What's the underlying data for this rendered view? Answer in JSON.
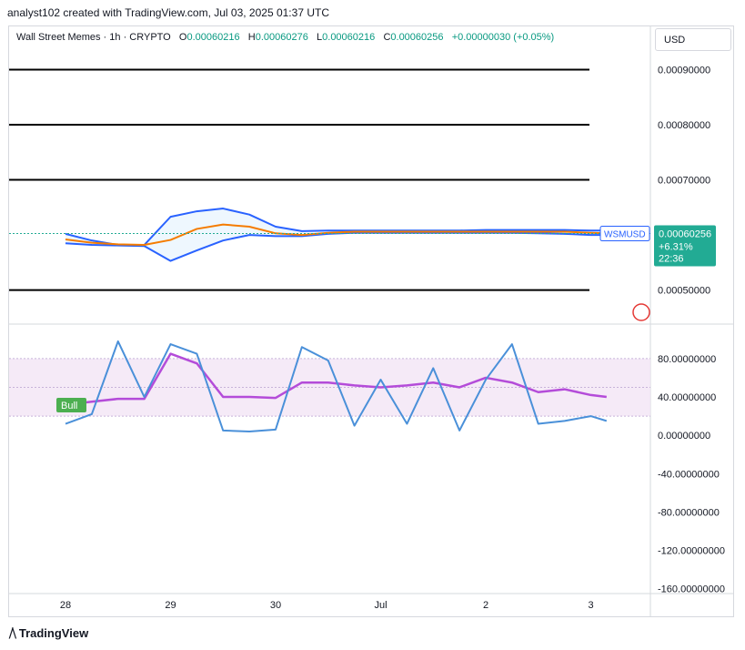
{
  "header": {
    "credit": "analyst102 created with TradingView.com, Jul 03, 2025 01:37 UTC",
    "symbol": "Wall Street Memes · 1h · CRYPTO",
    "o_label": "O",
    "o_value": "0.00060216",
    "h_label": "H",
    "h_value": "0.00060276",
    "l_label": "L",
    "l_value": "0.00060216",
    "c_label": "C",
    "c_value": "0.00060256",
    "change": "+0.00000030 (+0.05%)"
  },
  "toolbar": {
    "currency_label": "USD"
  },
  "price_tag": {
    "symbol": "WSMUSD",
    "price": "0.00060256",
    "change": "+6.31%",
    "countdown": "22:36"
  },
  "badge": {
    "label": "Bull"
  },
  "footer": {
    "brand": "TradingView"
  },
  "colors": {
    "upper_band": "#2962ff",
    "basis": "#f57c00",
    "stoch_k": "#4a90d9",
    "stoch_d": "#b44cd9",
    "tag_bg": "#22ab94",
    "bull": "#4caf50",
    "level_line": "#000000",
    "band_fill": "#e3f2fd",
    "osc_fill": "#f3e5f5"
  },
  "chart_data": [
    {
      "type": "line",
      "title": "Wall Street Memes · 1h · CRYPTO",
      "xlabel": "",
      "ylabel": "",
      "x_ticks": [
        "28",
        "29",
        "30",
        "Jul",
        "2",
        "3"
      ],
      "y_ticks": [
        "0.00090000",
        "0.00080000",
        "0.00070000",
        "0.00050000"
      ],
      "ylim": [
        0.00044,
        0.00098
      ],
      "horizontal_levels": [
        0.0009,
        0.0008,
        0.0007,
        0.0005
      ],
      "last_price": 0.00060256,
      "x": [
        0,
        0.25,
        0.5,
        0.75,
        1.0,
        1.25,
        1.5,
        1.75,
        2.0,
        2.25,
        2.5,
        2.75,
        3.0,
        3.25,
        3.5,
        3.75,
        4.0,
        4.25,
        4.5,
        4.75,
        5.0,
        5.15
      ],
      "series": [
        {
          "values": [
            0.000592,
            0.000586,
            0.000583,
            0.000582,
            0.000591,
            0.000611,
            0.000619,
            0.000615,
            0.000603,
            0.0006,
            0.000604,
            0.000606,
            0.000606,
            0.000606,
            0.000606,
            0.000606,
            0.000606,
            0.000606,
            0.000606,
            0.000606,
            0.000604,
            0.000603
          ]
        },
        {
          "values": [
            0.000602,
            0.00059,
            0.000582,
            0.000582,
            0.000633,
            0.000643,
            0.000648,
            0.000637,
            0.000615,
            0.000607,
            0.000608,
            0.000608,
            0.000608,
            0.000608,
            0.000608,
            0.000608,
            0.000609,
            0.000609,
            0.000609,
            0.000609,
            0.000608,
            0.000608
          ]
        },
        {
          "values": [
            0.000585,
            0.000582,
            0.000581,
            0.00058,
            0.000553,
            0.000572,
            0.00059,
            0.0006,
            0.000598,
            0.000598,
            0.000602,
            0.000604,
            0.000604,
            0.000604,
            0.000604,
            0.000604,
            0.000604,
            0.000604,
            0.000603,
            0.000602,
            0.0006,
            0.0006
          ]
        }
      ]
    },
    {
      "type": "line",
      "title": "",
      "y_ticks": [
        "80.00000000",
        "40.00000000",
        "0.00000000",
        "-40.00000000",
        "-80.00000000",
        "-120.00000000",
        "-160.00000000"
      ],
      "ylim": [
        -165,
        115
      ],
      "band_upper": 80,
      "band_lower": 20,
      "band_mid": 50,
      "x": [
        0,
        0.25,
        0.5,
        0.75,
        1.0,
        1.25,
        1.5,
        1.75,
        2.0,
        2.25,
        2.5,
        2.75,
        3.0,
        3.25,
        3.5,
        3.75,
        4.0,
        4.25,
        4.5,
        4.75,
        5.0,
        5.15
      ],
      "series": [
        {
          "values": [
            12,
            22,
            98,
            40,
            95,
            85,
            5,
            4,
            6,
            92,
            78,
            10,
            58,
            12,
            70,
            5,
            58,
            95,
            12,
            15,
            20,
            15
          ]
        },
        {
          "values": [
            32,
            35,
            38,
            38,
            85,
            75,
            40,
            40,
            39,
            55,
            55,
            52,
            50,
            52,
            55,
            50,
            60,
            55,
            45,
            48,
            42,
            40
          ]
        }
      ]
    }
  ]
}
